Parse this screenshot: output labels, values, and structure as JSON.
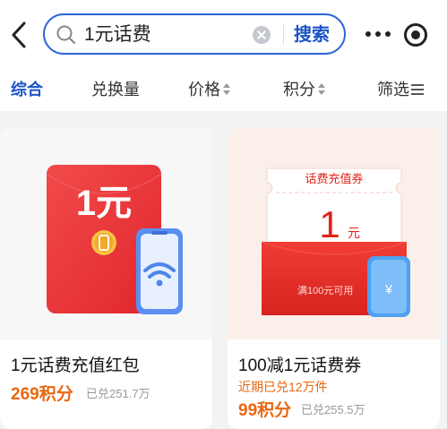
{
  "search": {
    "query": "1元话费",
    "button_label": "搜索"
  },
  "sort_tabs": [
    {
      "label": "综合",
      "active": true
    },
    {
      "label": "兑换量"
    },
    {
      "label": "价格"
    },
    {
      "label": "积分"
    },
    {
      "label": "筛选"
    }
  ],
  "products": [
    {
      "title": "1元话费充值红包",
      "image_text": "1元",
      "price": "269积分",
      "exchanged": "已兑251.7万"
    },
    {
      "title": "100减1元话费券",
      "image_banner": "话费充值券",
      "image_amount": "1",
      "image_unit": "元",
      "image_condition": "满100元可用",
      "image_currency": "¥",
      "recent_sold": "近期已兑12万件",
      "price": "99积分",
      "exchanged": "已兑255.5万"
    }
  ],
  "colors": {
    "accent_blue": "#1b54c9",
    "points_orange": "#e8670f",
    "red_envelope": "#ee2f2f"
  }
}
